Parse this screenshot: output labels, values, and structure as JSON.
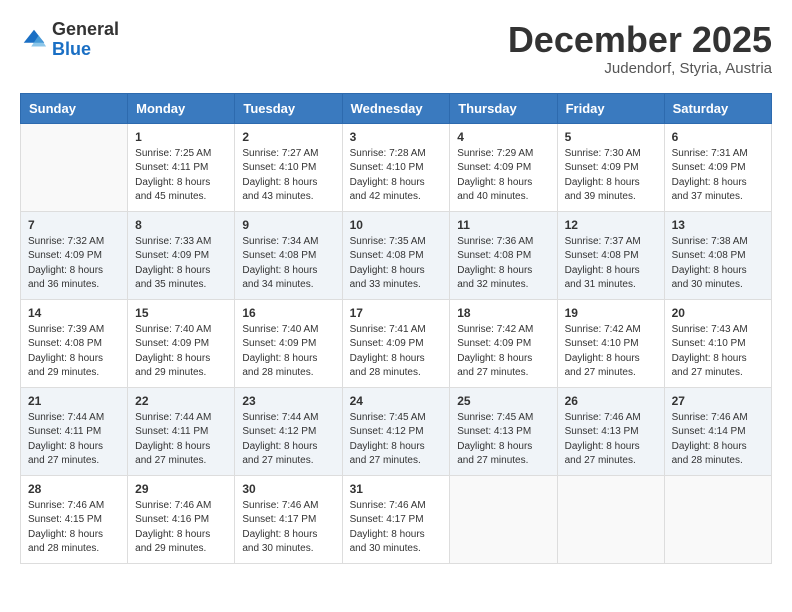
{
  "logo": {
    "general": "General",
    "blue": "Blue"
  },
  "header": {
    "month": "December 2025",
    "location": "Judendorf, Styria, Austria"
  },
  "days_of_week": [
    "Sunday",
    "Monday",
    "Tuesday",
    "Wednesday",
    "Thursday",
    "Friday",
    "Saturday"
  ],
  "weeks": [
    [
      {
        "day": null
      },
      {
        "day": 1,
        "sunrise": "7:25 AM",
        "sunset": "4:11 PM",
        "daylight": "8 hours and 45 minutes."
      },
      {
        "day": 2,
        "sunrise": "7:27 AM",
        "sunset": "4:10 PM",
        "daylight": "8 hours and 43 minutes."
      },
      {
        "day": 3,
        "sunrise": "7:28 AM",
        "sunset": "4:10 PM",
        "daylight": "8 hours and 42 minutes."
      },
      {
        "day": 4,
        "sunrise": "7:29 AM",
        "sunset": "4:09 PM",
        "daylight": "8 hours and 40 minutes."
      },
      {
        "day": 5,
        "sunrise": "7:30 AM",
        "sunset": "4:09 PM",
        "daylight": "8 hours and 39 minutes."
      },
      {
        "day": 6,
        "sunrise": "7:31 AM",
        "sunset": "4:09 PM",
        "daylight": "8 hours and 37 minutes."
      }
    ],
    [
      {
        "day": 7,
        "sunrise": "7:32 AM",
        "sunset": "4:09 PM",
        "daylight": "8 hours and 36 minutes."
      },
      {
        "day": 8,
        "sunrise": "7:33 AM",
        "sunset": "4:09 PM",
        "daylight": "8 hours and 35 minutes."
      },
      {
        "day": 9,
        "sunrise": "7:34 AM",
        "sunset": "4:08 PM",
        "daylight": "8 hours and 34 minutes."
      },
      {
        "day": 10,
        "sunrise": "7:35 AM",
        "sunset": "4:08 PM",
        "daylight": "8 hours and 33 minutes."
      },
      {
        "day": 11,
        "sunrise": "7:36 AM",
        "sunset": "4:08 PM",
        "daylight": "8 hours and 32 minutes."
      },
      {
        "day": 12,
        "sunrise": "7:37 AM",
        "sunset": "4:08 PM",
        "daylight": "8 hours and 31 minutes."
      },
      {
        "day": 13,
        "sunrise": "7:38 AM",
        "sunset": "4:08 PM",
        "daylight": "8 hours and 30 minutes."
      }
    ],
    [
      {
        "day": 14,
        "sunrise": "7:39 AM",
        "sunset": "4:08 PM",
        "daylight": "8 hours and 29 minutes."
      },
      {
        "day": 15,
        "sunrise": "7:40 AM",
        "sunset": "4:09 PM",
        "daylight": "8 hours and 29 minutes."
      },
      {
        "day": 16,
        "sunrise": "7:40 AM",
        "sunset": "4:09 PM",
        "daylight": "8 hours and 28 minutes."
      },
      {
        "day": 17,
        "sunrise": "7:41 AM",
        "sunset": "4:09 PM",
        "daylight": "8 hours and 28 minutes."
      },
      {
        "day": 18,
        "sunrise": "7:42 AM",
        "sunset": "4:09 PM",
        "daylight": "8 hours and 27 minutes."
      },
      {
        "day": 19,
        "sunrise": "7:42 AM",
        "sunset": "4:10 PM",
        "daylight": "8 hours and 27 minutes."
      },
      {
        "day": 20,
        "sunrise": "7:43 AM",
        "sunset": "4:10 PM",
        "daylight": "8 hours and 27 minutes."
      }
    ],
    [
      {
        "day": 21,
        "sunrise": "7:44 AM",
        "sunset": "4:11 PM",
        "daylight": "8 hours and 27 minutes."
      },
      {
        "day": 22,
        "sunrise": "7:44 AM",
        "sunset": "4:11 PM",
        "daylight": "8 hours and 27 minutes."
      },
      {
        "day": 23,
        "sunrise": "7:44 AM",
        "sunset": "4:12 PM",
        "daylight": "8 hours and 27 minutes."
      },
      {
        "day": 24,
        "sunrise": "7:45 AM",
        "sunset": "4:12 PM",
        "daylight": "8 hours and 27 minutes."
      },
      {
        "day": 25,
        "sunrise": "7:45 AM",
        "sunset": "4:13 PM",
        "daylight": "8 hours and 27 minutes."
      },
      {
        "day": 26,
        "sunrise": "7:46 AM",
        "sunset": "4:13 PM",
        "daylight": "8 hours and 27 minutes."
      },
      {
        "day": 27,
        "sunrise": "7:46 AM",
        "sunset": "4:14 PM",
        "daylight": "8 hours and 28 minutes."
      }
    ],
    [
      {
        "day": 28,
        "sunrise": "7:46 AM",
        "sunset": "4:15 PM",
        "daylight": "8 hours and 28 minutes."
      },
      {
        "day": 29,
        "sunrise": "7:46 AM",
        "sunset": "4:16 PM",
        "daylight": "8 hours and 29 minutes."
      },
      {
        "day": 30,
        "sunrise": "7:46 AM",
        "sunset": "4:17 PM",
        "daylight": "8 hours and 30 minutes."
      },
      {
        "day": 31,
        "sunrise": "7:46 AM",
        "sunset": "4:17 PM",
        "daylight": "8 hours and 30 minutes."
      },
      {
        "day": null
      },
      {
        "day": null
      },
      {
        "day": null
      }
    ]
  ]
}
